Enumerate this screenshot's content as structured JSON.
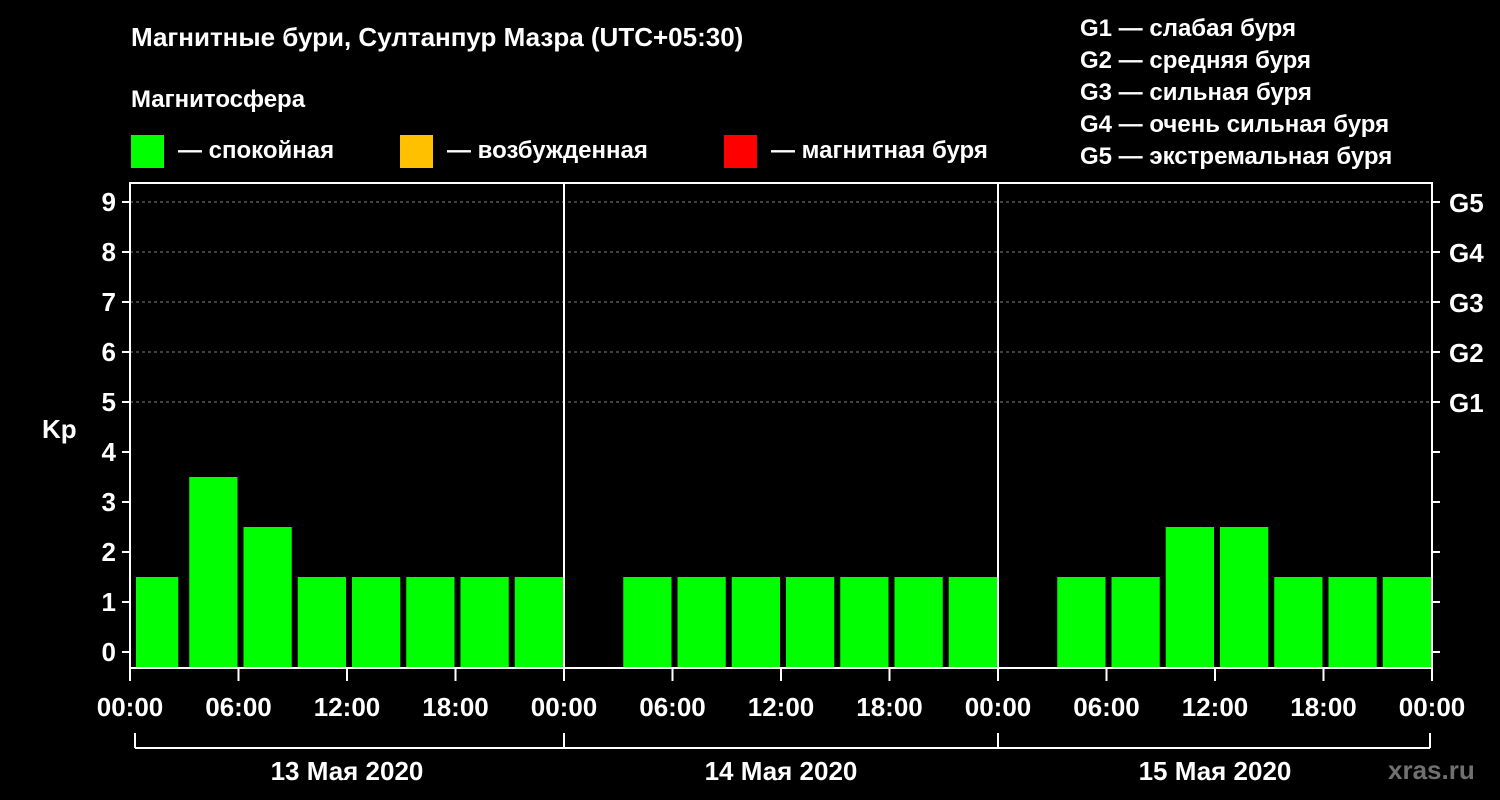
{
  "chart_data": {
    "type": "bar",
    "title": "Магнитные бури, Султанпур Мазра (UTC+05:30)",
    "subtitle": "Магнитосфера",
    "ylabel": "Kp",
    "ylim": [
      0,
      9
    ],
    "yticks": [
      "0",
      "1",
      "2",
      "3",
      "4",
      "5",
      "6",
      "7",
      "8",
      "9"
    ],
    "grid": true,
    "legend": [
      {
        "label": "— спокойная",
        "color": "#00ff00"
      },
      {
        "label": "— возбужденная",
        "color": "#ffc000"
      },
      {
        "label": "— магнитная буря",
        "color": "#ff0000"
      }
    ],
    "storm_scale": [
      {
        "label": "G1 — слабая буря"
      },
      {
        "label": "G2 — средняя буря"
      },
      {
        "label": "G3 — сильная буря"
      },
      {
        "label": "G4 — очень сильная буря"
      },
      {
        "label": "G5 — экстремальная буря"
      }
    ],
    "right_axis": [
      {
        "kp": 5,
        "label": "G1"
      },
      {
        "kp": 6,
        "label": "G2"
      },
      {
        "kp": 7,
        "label": "G3"
      },
      {
        "kp": 8,
        "label": "G4"
      },
      {
        "kp": 9,
        "label": "G5"
      }
    ],
    "days": [
      {
        "label": "13 Мая 2020",
        "values": [
          1,
          3,
          2,
          1,
          1,
          1,
          1,
          1
        ]
      },
      {
        "label": "14 Мая 2020",
        "values": [
          0,
          1,
          1,
          1,
          1,
          1,
          1,
          1
        ]
      },
      {
        "label": "15 Мая 2020",
        "values": [
          0,
          1,
          1,
          2,
          2,
          1,
          1,
          1
        ]
      }
    ],
    "xticks": [
      "00:00",
      "06:00",
      "12:00",
      "18:00",
      "00:00",
      "06:00",
      "12:00",
      "18:00",
      "00:00",
      "06:00",
      "12:00",
      "18:00",
      "00:00"
    ],
    "bar_color": "#00ff00"
  },
  "watermark": "xras.ru"
}
